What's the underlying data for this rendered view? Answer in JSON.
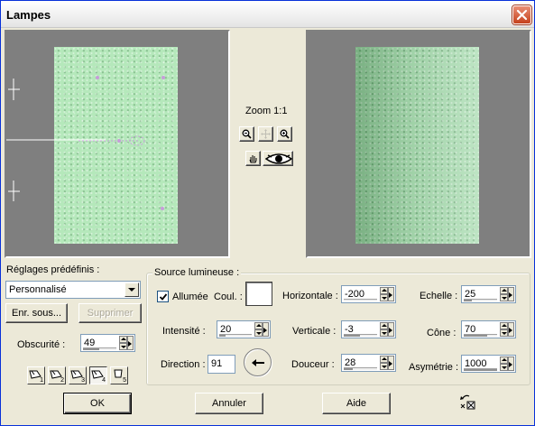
{
  "window": {
    "title": "Lampes"
  },
  "icons": {
    "close": "close-icon",
    "zoom_out": "zoom-out-icon",
    "zoom_fit": "zoom-fit-icon",
    "zoom_in": "zoom-in-icon",
    "pan": "hand-icon",
    "preview_toggle": "eye-icon",
    "reset": "reset-icon",
    "direction": "arrow-left-icon",
    "preset": "lamp-icon"
  },
  "colors": {
    "paper": "#b5e8bb",
    "titlebar": "#f3f3f3",
    "close": "#c5411c"
  },
  "preview": {
    "zoom_label": "Zoom 1:1"
  },
  "presets": {
    "label": "Réglages prédéfinis :",
    "selected": "Personnalisé",
    "save_label": "Enr. sous...",
    "delete_label": "Supprimer",
    "darkness_label": "Obscurité :",
    "darkness_value": "49",
    "lamp_buttons": [
      "1",
      "2",
      "3",
      "4",
      "5"
    ],
    "active_lamp": "4"
  },
  "light_source": {
    "group_label": "Source lumineuse :",
    "on_label": "Allumée",
    "on_checked": true,
    "color_label": "Coul. :",
    "intensity_label": "Intensité :",
    "intensity_value": "20",
    "direction_label": "Direction :",
    "direction_value": "91",
    "horizontal_label": "Horizontale :",
    "horizontal_value": "-200",
    "vertical_label": "Verticale :",
    "vertical_value": "-3",
    "softness_label": "Douceur :",
    "softness_value": "28",
    "scale_label": "Echelle :",
    "scale_value": "25",
    "cone_label": "Cône :",
    "cone_value": "70",
    "asymmetry_label": "Asymétrie :",
    "asymmetry_value": "1000"
  },
  "buttons": {
    "ok": "OK",
    "cancel": "Annuler",
    "help": "Aide"
  }
}
